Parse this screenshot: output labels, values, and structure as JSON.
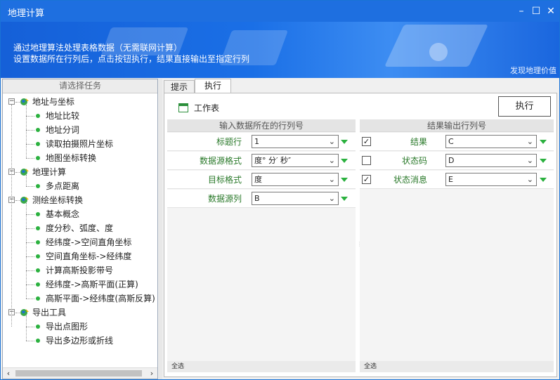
{
  "window": {
    "title": "地理计算",
    "controls": {
      "minimize": "–",
      "maximize": "☐",
      "close": "✕"
    }
  },
  "banner": {
    "line1": "通过地理算法处理表格数据（无需联网计算）",
    "line2": "设置数据所在行列后，点击按钮执行，结果直接输出至指定行列",
    "link": "发现地理价值"
  },
  "sidebar": {
    "header": "请选择任务",
    "groups": [
      {
        "label": "地址与坐标",
        "items": [
          "地址比较",
          "地址分词",
          "读取拍摄照片坐标",
          "地图坐标转换"
        ]
      },
      {
        "label": "地理计算",
        "items": [
          "多点距离"
        ]
      },
      {
        "label": "测绘坐标转换",
        "items": [
          "基本概念",
          "度分秒、弧度、度",
          "经纬度->空间直角坐标",
          "空间直角坐标->经纬度",
          "计算高斯投影带号",
          "经纬度->高斯平面(正算)",
          "高斯平面->经纬度(高斯反算)"
        ]
      },
      {
        "label": "导出工具",
        "items": [
          "导出点图形",
          "导出多边形或折线"
        ]
      }
    ],
    "scroll_left": "‹",
    "scroll_right": "›"
  },
  "tabs": [
    {
      "label": "提示"
    },
    {
      "label": "执行"
    }
  ],
  "main": {
    "workbook_label": "工作表",
    "run_button": "执行",
    "input_panel": {
      "header": "输入数据所在的行列号",
      "rows": [
        {
          "label": "标题行",
          "value": "1"
        },
        {
          "label": "数据源格式",
          "value": "度° 分′ 秒″"
        },
        {
          "label": "目标格式",
          "value": "度"
        },
        {
          "label": "数据源列",
          "value": "B"
        }
      ],
      "footer": "全选"
    },
    "output_panel": {
      "header": "结果输出行列号",
      "rows": [
        {
          "label": "结果",
          "value": "C",
          "checked": true
        },
        {
          "label": "状态码",
          "value": "D",
          "checked": false
        },
        {
          "label": "状态消息",
          "value": "E",
          "checked": true
        }
      ],
      "footer": "全选"
    }
  },
  "colors": {
    "accent": "#1e6fe0",
    "green": "#2bb13f"
  }
}
